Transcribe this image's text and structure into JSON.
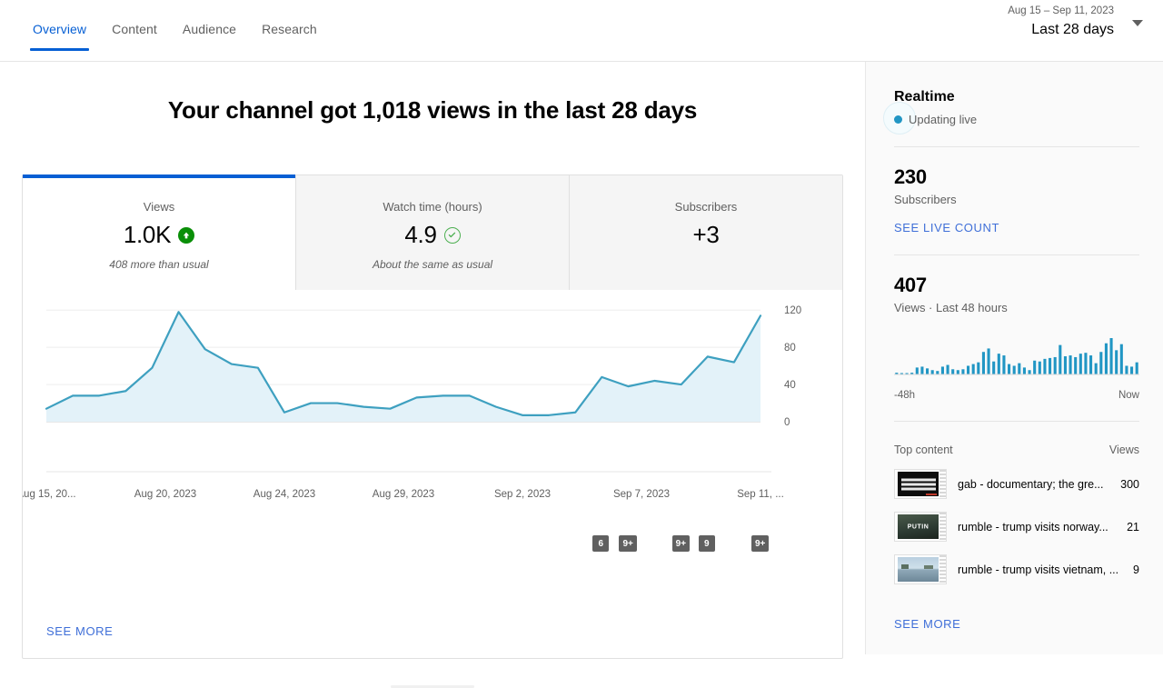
{
  "header": {
    "tabs": [
      {
        "label": "Overview",
        "active": true
      },
      {
        "label": "Content",
        "active": false
      },
      {
        "label": "Audience",
        "active": false
      },
      {
        "label": "Research",
        "active": false
      }
    ],
    "date_range": {
      "range_text": "Aug 15 – Sep 11, 2023",
      "preset_label": "Last 28 days",
      "caret_icon": "chevron-down-icon"
    }
  },
  "main": {
    "headline": "Your channel got 1,018 views in the last 28 days",
    "metrics": [
      {
        "label": "Views",
        "value": "1.0K",
        "note": "408 more than usual",
        "status_icon": "arrow-up-circle-icon",
        "status_color": "#0a8f08",
        "selected": true
      },
      {
        "label": "Watch time (hours)",
        "value": "4.9",
        "note": "About the same as usual",
        "status_icon": "check-circle-icon",
        "status_color": "#4caf50",
        "selected": false
      },
      {
        "label": "Subscribers",
        "value": "+3",
        "note": "",
        "status_icon": "",
        "status_color": "",
        "selected": false
      }
    ],
    "see_more_label": "SEE MORE"
  },
  "chart_data": {
    "type": "area",
    "title": "",
    "xlabel": "",
    "ylabel": "",
    "ylim": [
      0,
      130
    ],
    "yticks": [
      0,
      40,
      80,
      120
    ],
    "grid": true,
    "legend": "none",
    "line_color": "#3ea0c0",
    "fill_color": "#e3f2f9",
    "x_tick_labels": [
      "Aug 15, 20...",
      "Aug 20, 2023",
      "Aug 24, 2023",
      "Aug 29, 2023",
      "Sep 2, 2023",
      "Sep 7, 2023",
      "Sep 11, ..."
    ],
    "categories": [
      "Aug 15",
      "Aug 16",
      "Aug 17",
      "Aug 18",
      "Aug 19",
      "Aug 20",
      "Aug 21",
      "Aug 22",
      "Aug 23",
      "Aug 24",
      "Aug 25",
      "Aug 26",
      "Aug 27",
      "Aug 28",
      "Aug 29",
      "Aug 30",
      "Aug 31",
      "Sep 1",
      "Sep 2",
      "Sep 3",
      "Sep 4",
      "Sep 5",
      "Sep 6",
      "Sep 7",
      "Sep 8",
      "Sep 9",
      "Sep 10",
      "Sep 11"
    ],
    "values": [
      14,
      28,
      28,
      33,
      58,
      118,
      78,
      62,
      58,
      10,
      20,
      20,
      16,
      14,
      26,
      28,
      28,
      16,
      7,
      7,
      10,
      48,
      38,
      44,
      40,
      70,
      64,
      114
    ],
    "video_markers": [
      {
        "label": "6",
        "x_index": 21
      },
      {
        "label": "9+",
        "x_index": 22
      },
      {
        "label": "9+",
        "x_index": 24
      },
      {
        "label": "9",
        "x_index": 25
      },
      {
        "label": "9+",
        "x_index": 27
      }
    ]
  },
  "realtime": {
    "title": "Realtime",
    "live_status": "Updating live",
    "live_dot_color": "#2196c4",
    "subscribers": {
      "count": "230",
      "label": "Subscribers",
      "link_label": "SEE LIVE COUNT"
    },
    "views": {
      "count": "407",
      "label": "Views · Last 48 hours",
      "axis_start": "-48h",
      "axis_end": "Now",
      "bar_color": "#2196c4",
      "bars": [
        2,
        1,
        1,
        2,
        8,
        9,
        7,
        5,
        4,
        9,
        11,
        6,
        5,
        6,
        10,
        12,
        14,
        26,
        30,
        15,
        24,
        22,
        12,
        10,
        13,
        8,
        5,
        16,
        15,
        18,
        19,
        20,
        34,
        21,
        22,
        20,
        24,
        25,
        22,
        13,
        26,
        36,
        42,
        28,
        35,
        10,
        9,
        14
      ]
    },
    "top_content": {
      "col_title": "Top content",
      "col_views": "Views",
      "rows": [
        {
          "title": "gab - documentary; the gre...",
          "views": "300",
          "thumb": "dark-title-card"
        },
        {
          "title": "rumble - trump visits norway...",
          "views": "21",
          "thumb": "putin-card"
        },
        {
          "title": "rumble - trump visits vietnam, ...",
          "views": "9",
          "thumb": "water-scene-card"
        }
      ],
      "see_more_label": "SEE MORE"
    }
  }
}
